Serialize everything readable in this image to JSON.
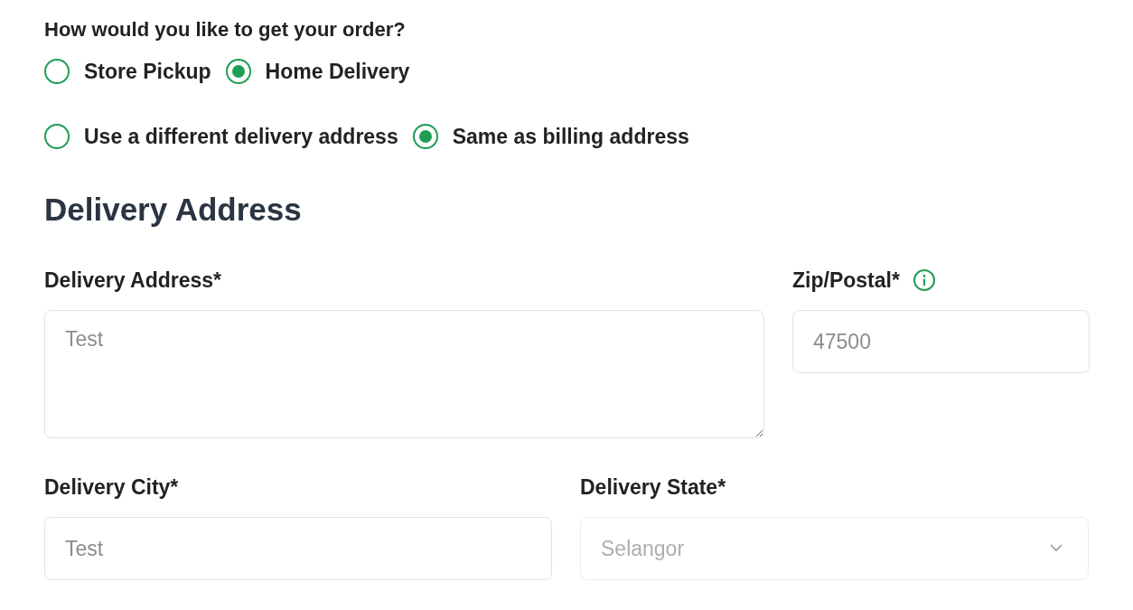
{
  "question": "How would you like to get your order?",
  "delivery_methods": [
    {
      "label": "Store Pickup",
      "selected": false
    },
    {
      "label": "Home Delivery",
      "selected": true
    }
  ],
  "address_options": [
    {
      "label": "Use a different delivery address",
      "selected": false
    },
    {
      "label": "Same as billing address",
      "selected": true
    }
  ],
  "section_title": "Delivery Address",
  "fields": [
    {
      "kind": "textarea",
      "label": "Delivery Address*",
      "value": "Test",
      "disabled": true
    },
    {
      "kind": "text",
      "label": "Zip/Postal*",
      "value": "47500",
      "info": true,
      "disabled": true
    },
    {
      "kind": "text",
      "label": "Delivery City*",
      "value": "Test",
      "disabled": true
    },
    {
      "kind": "select",
      "label": "Delivery State*",
      "value": "Selangor",
      "disabled": true
    }
  ]
}
